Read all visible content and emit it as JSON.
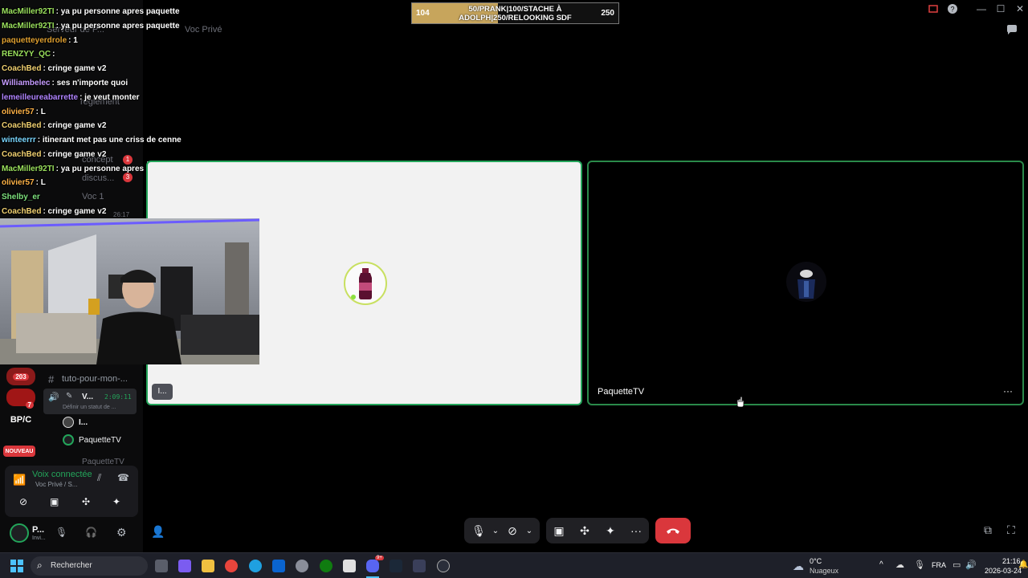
{
  "window": {
    "channel_title": "Voc Privé"
  },
  "progress_overlay": {
    "left_value": "104",
    "right_value": "250",
    "text_line1": "50/PRANK|100/STACHE À",
    "text_line2": "ADOLPH|250/RELOOKING SDF",
    "fill_fraction": 0.416
  },
  "chat": [
    {
      "user": "MacMiller92TI",
      "user_color": "#9be15d",
      "message": ": ya pu personne apres paquette"
    },
    {
      "user": "MacMiller92TI",
      "user_color": "#9be15d",
      "message": ": ya pu personne apres paquette"
    },
    {
      "user": "paquetteyerdrole",
      "user_color": "#e0a030",
      "message": ": 1"
    },
    {
      "user": "RENZYY_QC",
      "user_color": "#9be15d",
      "message": ":"
    },
    {
      "user": "CoachBed",
      "user_color": "#f0d070",
      "message": ": cringe game v2"
    },
    {
      "user": "Williambelec",
      "user_color": "#c59bff",
      "message": ": ses n'importe quoi"
    },
    {
      "user": "lemeilleureabarrette",
      "user_color": "#b084ff",
      "message": ": je veut monter"
    },
    {
      "user": "olivier57",
      "user_color": "#ffb347",
      "message": ": L"
    },
    {
      "user": "CoachBed",
      "user_color": "#f0d070",
      "message": ": cringe game v2"
    },
    {
      "user": "winteerrr",
      "user_color": "#7ad7ff",
      "message": ": itinerant met pas une criss de cenne"
    },
    {
      "user": "CoachBed",
      "user_color": "#f0d070",
      "message": ": cringe game v2"
    },
    {
      "user": "MacMiller92TI",
      "user_color": "#9be15d",
      "message": ": ya pu personne apres paquette"
    },
    {
      "user": "olivier57",
      "user_color": "#ffb347",
      "message": ": L"
    },
    {
      "user": "Shelby_er",
      "user_color": "#7de07d",
      "message": ""
    },
    {
      "user": "CoachBed",
      "user_color": "#f0d070",
      "message": ": cringe game v2"
    }
  ],
  "faded_channels": {
    "server_header": "Serveur de P...",
    "reglement": "règlement",
    "concept": "concept",
    "discussion": "discus...",
    "voc1": "Voc 1",
    "timer": "26:17",
    "badge_1": "1",
    "badge_3": "3"
  },
  "channels": {
    "tuto": "tuto-pour-mon-...",
    "voice_channel_name": "V...",
    "voice_timer": "2:09:11",
    "status_placeholder": "Définir un statut de ...",
    "member_1": "I...",
    "member_2": "PaquetteTV",
    "member_3": "PaquetteTV"
  },
  "servers": {
    "badge_203": "203",
    "badge_7": "7",
    "bpc_label": "BP/C",
    "new_label": "NOUVEAU"
  },
  "voice_panel": {
    "status": "Voix connectée",
    "location": "Voc Privé / S..."
  },
  "user_panel": {
    "name": "P...",
    "status": "Invi..."
  },
  "tiles": {
    "tile1_label": "I...",
    "tile2_label": "PaquetteTV"
  },
  "taskbar": {
    "search_label": "Rechercher",
    "weather_temp": "0°C",
    "weather_desc": "Nuageux",
    "lang": "FRA",
    "time": "21:16",
    "date": "2026-03-24",
    "discord_badge": "9+"
  },
  "colors": {
    "accent_green": "#23a55a",
    "hangup_red": "#da373c",
    "progress_gold": "#c7a55c"
  }
}
